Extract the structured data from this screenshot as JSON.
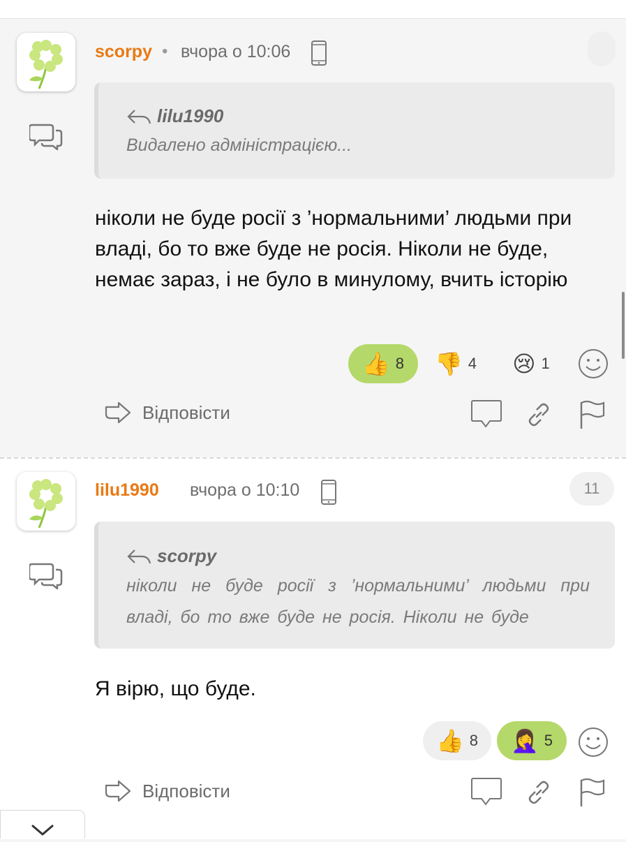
{
  "comments": [
    {
      "author": "scorpy",
      "separator": "•",
      "time": "вчора о 10:06",
      "quote": {
        "author": "lilu1990",
        "text": "Видалено адміністрацією..."
      },
      "body": "ніколи не буде росії з ’нормальними’ людьми при владі, бо то вже буде не росія. Ніколи не буде, немає зараз, і не було в минулому, вчить історію",
      "reactions": [
        {
          "icon": "thumbs-up-icon",
          "emoji": "👍",
          "count": "8",
          "active": true
        },
        {
          "icon": "thumbs-down-icon",
          "emoji": "👎",
          "count": "4",
          "active": false
        },
        {
          "icon": "crying-face-icon",
          "emoji": "😢",
          "count": "1",
          "active": false
        }
      ],
      "reply_label": "Відповісти"
    },
    {
      "author": "lilu1990",
      "time": "вчора о 10:10",
      "reply_count": "11",
      "quote": {
        "author": "scorpy",
        "text": "ніколи не буде росії з ’нормальними’ людьми при владі, бо то вже буде не росія. Ніколи не буде"
      },
      "body": "Я вірю, що буде.",
      "reactions": [
        {
          "icon": "thumbs-up-icon",
          "emoji": "👍",
          "count": "8",
          "active": false
        },
        {
          "icon": "facepalm-icon",
          "emoji": "🤦‍♀️",
          "count": "5",
          "active": true
        }
      ],
      "reply_label": "Відповісти"
    }
  ],
  "colors": {
    "author": "#e87a14",
    "reaction_active": "#b5d86a",
    "background": "#f5f5f5"
  }
}
